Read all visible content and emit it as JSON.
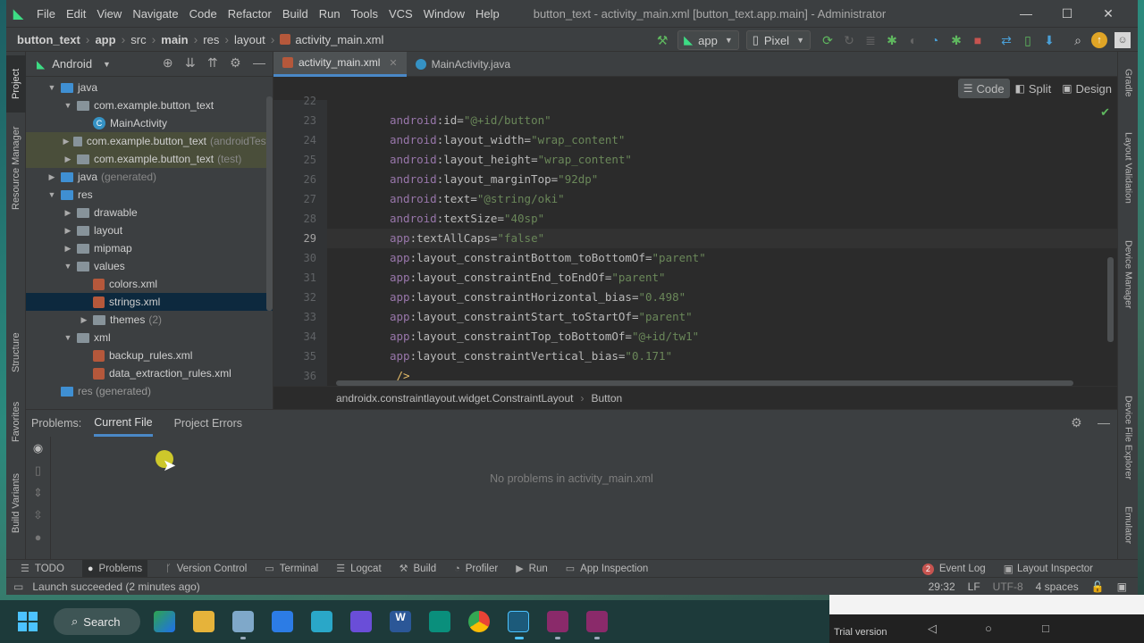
{
  "window": {
    "title": "button_text - activity_main.xml [button_text.app.main] - Administrator",
    "minimize": "—",
    "maximize": "☐",
    "close": "✕"
  },
  "menu": [
    "File",
    "Edit",
    "View",
    "Navigate",
    "Code",
    "Refactor",
    "Build",
    "Run",
    "Tools",
    "VCS",
    "Window",
    "Help"
  ],
  "breadcrumb": [
    "button_text",
    "app",
    "src",
    "main",
    "res",
    "layout",
    "activity_main.xml"
  ],
  "toolbar": {
    "config": "app",
    "device": "Pixel"
  },
  "project": {
    "view": "Android",
    "tree": [
      {
        "label": "java",
        "depth": 1,
        "chev": "▼",
        "icon": "fold-blue"
      },
      {
        "label": "com.example.button_text",
        "depth": 2,
        "chev": "▼",
        "icon": "fold"
      },
      {
        "label": "MainActivity",
        "depth": 3,
        "chev": "",
        "icon": "class"
      },
      {
        "label": "com.example.button_text",
        "suffix": "(androidTest)",
        "depth": 2,
        "chev": "▶",
        "icon": "fold",
        "hl": true
      },
      {
        "label": "com.example.button_text",
        "suffix": "(test)",
        "depth": 2,
        "chev": "▶",
        "icon": "fold",
        "hl": true
      },
      {
        "label": "java",
        "suffix": "(generated)",
        "depth": 1,
        "chev": "▶",
        "icon": "fold-blue"
      },
      {
        "label": "res",
        "depth": 1,
        "chev": "▼",
        "icon": "fold-blue"
      },
      {
        "label": "drawable",
        "depth": 2,
        "chev": "▶",
        "icon": "fold"
      },
      {
        "label": "layout",
        "depth": 2,
        "chev": "▶",
        "icon": "fold"
      },
      {
        "label": "mipmap",
        "depth": 2,
        "chev": "▶",
        "icon": "fold"
      },
      {
        "label": "values",
        "depth": 2,
        "chev": "▼",
        "icon": "fold"
      },
      {
        "label": "colors.xml",
        "depth": 3,
        "chev": "",
        "icon": "xml"
      },
      {
        "label": "strings.xml",
        "depth": 3,
        "chev": "",
        "icon": "xml",
        "sel": true
      },
      {
        "label": "themes",
        "suffix": "(2)",
        "depth": 3,
        "chev": "▶",
        "icon": "fold"
      },
      {
        "label": "xml",
        "depth": 2,
        "chev": "▼",
        "icon": "fold"
      },
      {
        "label": "backup_rules.xml",
        "depth": 3,
        "chev": "",
        "icon": "xml"
      },
      {
        "label": "data_extraction_rules.xml",
        "depth": 3,
        "chev": "",
        "icon": "xml"
      },
      {
        "label": "res (generated)",
        "depth": 1,
        "chev": "",
        "icon": "fold-blue",
        "gen": true
      }
    ]
  },
  "editor": {
    "tabs": [
      {
        "label": "activity_main.xml",
        "active": true,
        "color": "#b5583b"
      },
      {
        "label": "MainActivity.java",
        "active": false,
        "color": "#3592c4"
      }
    ],
    "modes": [
      {
        "label": "Code",
        "glyph": "☰",
        "active": true
      },
      {
        "label": "Split",
        "glyph": "◧",
        "active": false
      },
      {
        "label": "Design",
        "glyph": "▣",
        "active": false
      }
    ],
    "current_line": 29,
    "lines": [
      {
        "n": "22",
        "ns": "",
        "attr": "",
        "val": ""
      },
      {
        "n": "23",
        "ns": "android",
        "attr": "id",
        "val": "\"@+id/button\""
      },
      {
        "n": "24",
        "ns": "android",
        "attr": "layout_width",
        "val": "\"wrap_content\""
      },
      {
        "n": "25",
        "ns": "android",
        "attr": "layout_height",
        "val": "\"wrap_content\""
      },
      {
        "n": "26",
        "ns": "android",
        "attr": "layout_marginTop",
        "val": "\"92dp\""
      },
      {
        "n": "27",
        "ns": "android",
        "attr": "text",
        "val": "\"@string/oki\""
      },
      {
        "n": "28",
        "ns": "android",
        "attr": "textSize",
        "val": "\"40sp\""
      },
      {
        "n": "29",
        "ns": "app",
        "attr": "textAllCaps",
        "val": "\"false\""
      },
      {
        "n": "30",
        "ns": "app",
        "attr": "layout_constraintBottom_toBottomOf",
        "val": "\"parent\""
      },
      {
        "n": "31",
        "ns": "app",
        "attr": "layout_constraintEnd_toEndOf",
        "val": "\"parent\""
      },
      {
        "n": "32",
        "ns": "app",
        "attr": "layout_constraintHorizontal_bias",
        "val": "\"0.498\""
      },
      {
        "n": "33",
        "ns": "app",
        "attr": "layout_constraintStart_toStartOf",
        "val": "\"parent\""
      },
      {
        "n": "34",
        "ns": "app",
        "attr": "layout_constraintTop_toBottomOf",
        "val": "\"@+id/tw1\""
      },
      {
        "n": "35",
        "ns": "app",
        "attr": "layout_constraintVertical_bias",
        "val": "\"0.171\""
      },
      {
        "n": "36",
        "ns": "",
        "attr": "",
        "val": "",
        "raw": " />"
      }
    ],
    "crumbs": [
      "androidx.constraintlayout.widget.ConstraintLayout",
      "Button"
    ]
  },
  "problems": {
    "label": "Problems:",
    "tabs": [
      "Current File",
      "Project Errors"
    ],
    "empty": "No problems in activity_main.xml"
  },
  "left_tabs": [
    "Project",
    "Resource Manager",
    "Structure",
    "Favorites",
    "Build Variants"
  ],
  "right_tabs": [
    "Gradle",
    "Layout Validation",
    "Device Manager",
    "Device File Explorer",
    "Emulator"
  ],
  "bottom_tools": [
    {
      "label": "TODO",
      "glyph": "☰"
    },
    {
      "label": "Problems",
      "glyph": "●",
      "active": true
    },
    {
      "label": "Version Control",
      "glyph": "ᚴ"
    },
    {
      "label": "Terminal",
      "glyph": "▭"
    },
    {
      "label": "Logcat",
      "glyph": "☰"
    },
    {
      "label": "Build",
      "glyph": "⚒"
    },
    {
      "label": "Profiler",
      "glyph": "◔"
    },
    {
      "label": "Run",
      "glyph": "▶"
    },
    {
      "label": "App Inspection",
      "glyph": "▭"
    }
  ],
  "bottom_right": {
    "event_count": "2",
    "event_log": "Event Log",
    "layout_inspector": "Layout Inspector"
  },
  "status": {
    "message": "Launch succeeded (2 minutes ago)",
    "position": "29:32",
    "line_sep": "LF",
    "encoding": "UTF-8",
    "indent": "4 spaces"
  },
  "taskbar": {
    "search": "Search"
  },
  "emulator": {
    "trial": "Trial version"
  }
}
